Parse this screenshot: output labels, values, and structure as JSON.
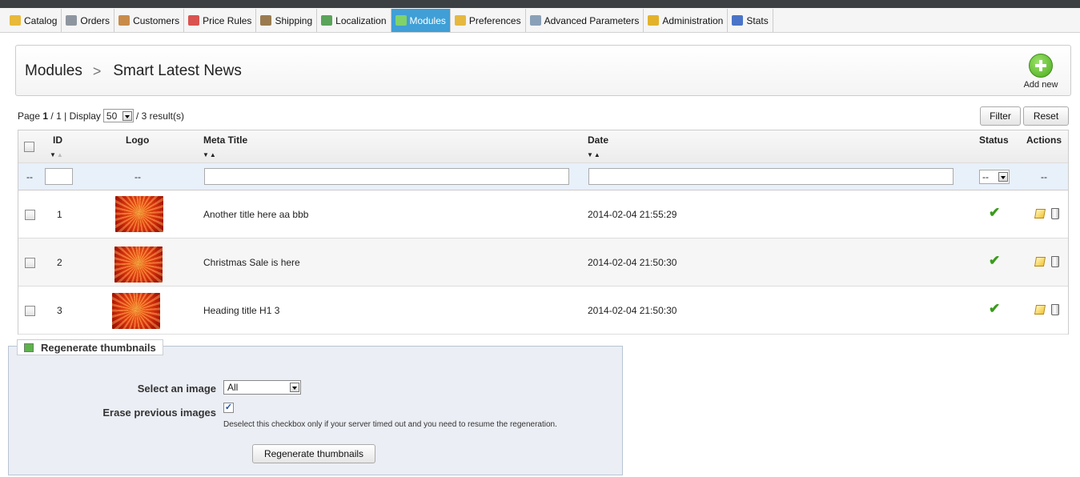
{
  "menu": {
    "items": [
      {
        "label": "Catalog",
        "icon": "folder-icon",
        "color": "#e8b93a"
      },
      {
        "label": "Orders",
        "icon": "cart-icon",
        "color": "#8d96a0"
      },
      {
        "label": "Customers",
        "icon": "user-icon",
        "color": "#c98b4a"
      },
      {
        "label": "Price Rules",
        "icon": "price-tag-icon",
        "color": "#d9534f"
      },
      {
        "label": "Shipping",
        "icon": "truck-icon",
        "color": "#9a7b4f"
      },
      {
        "label": "Localization",
        "icon": "globe-icon",
        "color": "#5aa35a"
      },
      {
        "label": "Modules",
        "icon": "puzzle-icon",
        "color": "#7fd36a",
        "active": true
      },
      {
        "label": "Preferences",
        "icon": "edit-icon",
        "color": "#e5b840"
      },
      {
        "label": "Advanced Parameters",
        "icon": "wrench-icon",
        "color": "#8aa0b8"
      },
      {
        "label": "Administration",
        "icon": "key-icon",
        "color": "#e3b22b"
      },
      {
        "label": "Stats",
        "icon": "bar-chart-icon",
        "color": "#4a74c8"
      }
    ]
  },
  "header": {
    "breadcrumb_root": "Modules",
    "breadcrumb_sep": ">",
    "breadcrumb_current": "Smart Latest News",
    "add_new": "Add new"
  },
  "list": {
    "page_prefix": "Page",
    "page_current": "1",
    "page_total": "1",
    "display_label": "Display",
    "display_value": "50",
    "results": "/ 3 result(s)",
    "filter": "Filter",
    "reset": "Reset",
    "columns": {
      "id": "ID",
      "logo": "Logo",
      "meta_title": "Meta Title",
      "date": "Date",
      "status": "Status",
      "actions": "Actions"
    },
    "filter_row": {
      "placeholder_dash": "--",
      "status_value": "--"
    },
    "rows": [
      {
        "id": "1",
        "title": "Another title here aa bbb",
        "date": "2014-02-04 21:55:29"
      },
      {
        "id": "2",
        "title": "Christmas Sale is here",
        "date": "2014-02-04 21:50:30"
      },
      {
        "id": "3",
        "title": "Heading title H1 3",
        "date": "2014-02-04 21:50:30"
      }
    ]
  },
  "regenerate": {
    "legend": "Regenerate thumbnails",
    "select_label": "Select an image",
    "select_value": "All",
    "erase_label": "Erase previous images",
    "erase_checked": "✓",
    "hint": "Deselect this checkbox only if your server timed out and you need to resume the regeneration.",
    "button": "Regenerate thumbnails"
  }
}
